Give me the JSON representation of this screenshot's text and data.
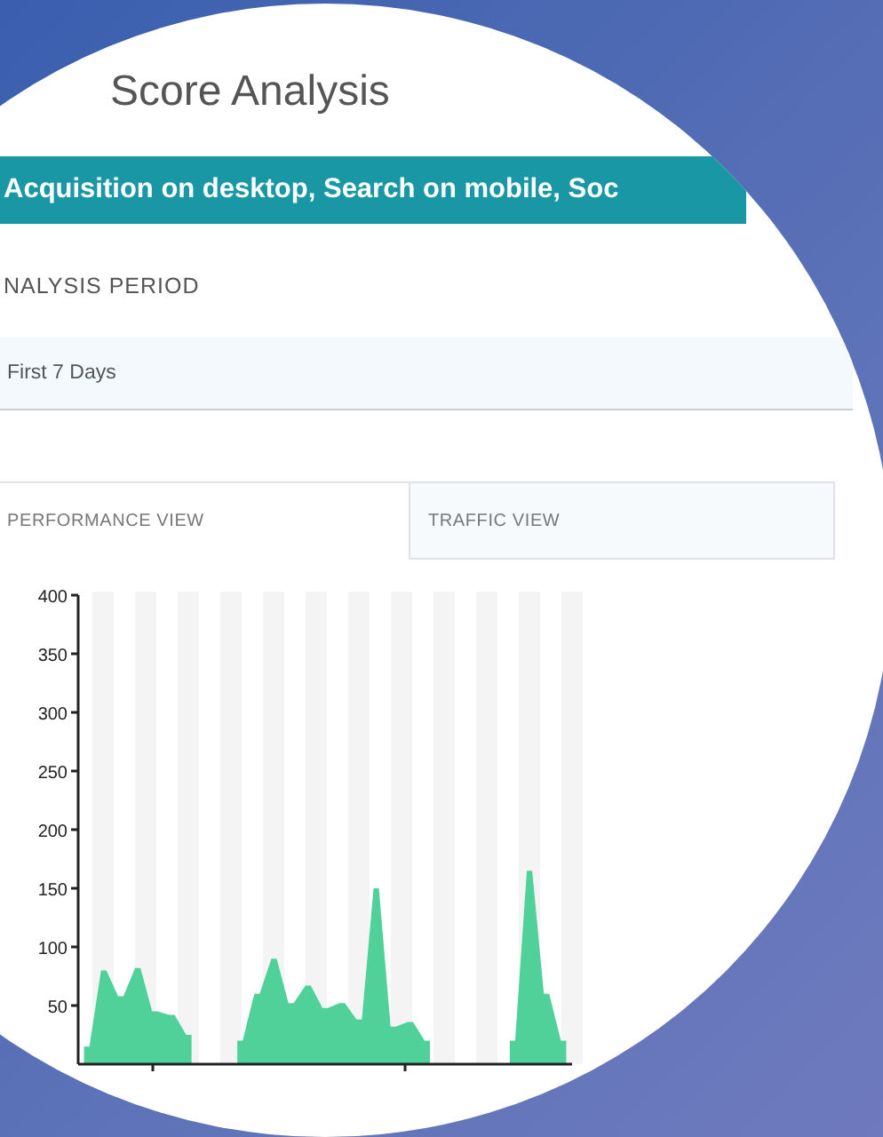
{
  "title": "Score Analysis",
  "banner": "Acquisition on desktop, Search on mobile, Soc",
  "period": {
    "label": "NALYSIS PERIOD",
    "value": "First 7 Days"
  },
  "tabs": [
    {
      "label": "PERFORMANCE VIEW",
      "selected": true
    },
    {
      "label": "TRAFFIC VIEW",
      "selected": false
    }
  ],
  "chart_data": {
    "type": "area",
    "ylim": [
      0,
      400
    ],
    "yticks": [
      50,
      100,
      150,
      200,
      250,
      300,
      350,
      400
    ],
    "series": [
      {
        "color": "#4fd199",
        "values": [
          15,
          80,
          58,
          82,
          45,
          42,
          25,
          null,
          null,
          20,
          60,
          90,
          52,
          67,
          48,
          52,
          38,
          150,
          32,
          36,
          20,
          null,
          null,
          null,
          null,
          20,
          165,
          60,
          20
        ]
      }
    ]
  }
}
